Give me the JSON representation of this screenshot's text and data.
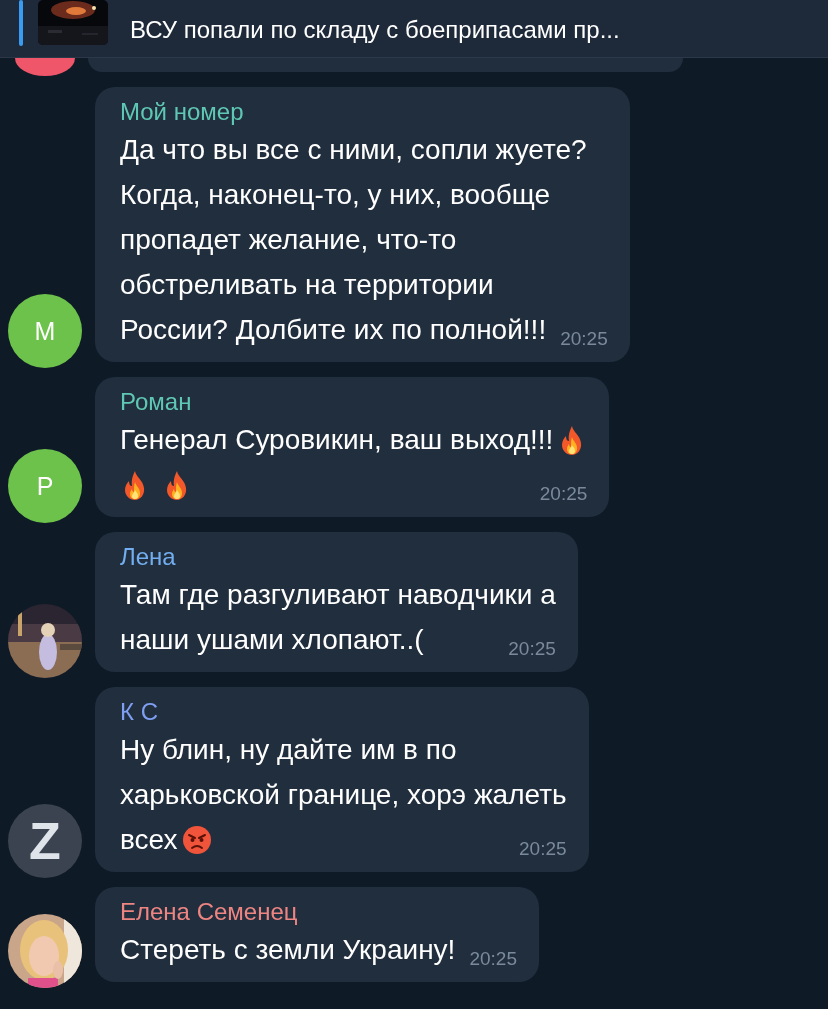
{
  "pinned_reply": {
    "thumbnail": {
      "kind": "picture"
    },
    "text": "ВСУ попали по складу с боеприпасами пр..."
  },
  "partial_message": {
    "avatar": {
      "kind": "blank",
      "color": "#f0566a"
    }
  },
  "messages": [
    {
      "name": "Мой номер",
      "color": "#5fc8b4",
      "avatar": {
        "kind": "letter",
        "letter": "М",
        "color": "#6cc24a"
      },
      "lines": [
        {
          "text": "Да что вы все с ними, сопли жуете?"
        },
        {
          "text": "Когда, наконец-то, у них, вообще"
        },
        {
          "text": "пропадет желание, что-то"
        },
        {
          "text": "обстреливать на территории"
        },
        {
          "text": "России? Долбите их по полной!!!"
        }
      ],
      "time": "20:25"
    },
    {
      "name": "Роман",
      "color": "#5fc8b4",
      "avatar": {
        "kind": "letter",
        "letter": "Р",
        "color": "#6cc24a"
      },
      "lines": [
        {
          "text": "Генерал Суровикин, ваш выход!!!",
          "icons": [
            {
              "kind": "fire"
            }
          ]
        },
        {
          "icons": [
            {
              "kind": "fire"
            },
            {
              "kind": "fire"
            }
          ]
        }
      ],
      "time": "20:25"
    },
    {
      "name": "Лена",
      "color": "#72aef0",
      "avatar": {
        "kind": "picture"
      },
      "lines": [
        {
          "text": "Там где разгуливают наводчики а"
        },
        {
          "text": "наши ушами хлопают..("
        }
      ],
      "time": "20:25"
    },
    {
      "name": "К С",
      "color": "#7f9ff2",
      "avatar": {
        "kind": "letter",
        "letter": "Z",
        "color": "#3b4350"
      },
      "lines": [
        {
          "text": "Ну блин, ну дайте им в по"
        },
        {
          "text": "харьковской границе, хорэ жалеть"
        },
        {
          "text": "всех",
          "icons": [
            {
              "kind": "angry"
            }
          ]
        }
      ],
      "time": "20:25"
    },
    {
      "name": "Елена Семенец",
      "color": "#ee8582",
      "avatar": {
        "kind": "picture"
      },
      "lines": [
        {
          "text": "Стереть с земли Украину!"
        }
      ],
      "time": "20:25"
    }
  ]
}
